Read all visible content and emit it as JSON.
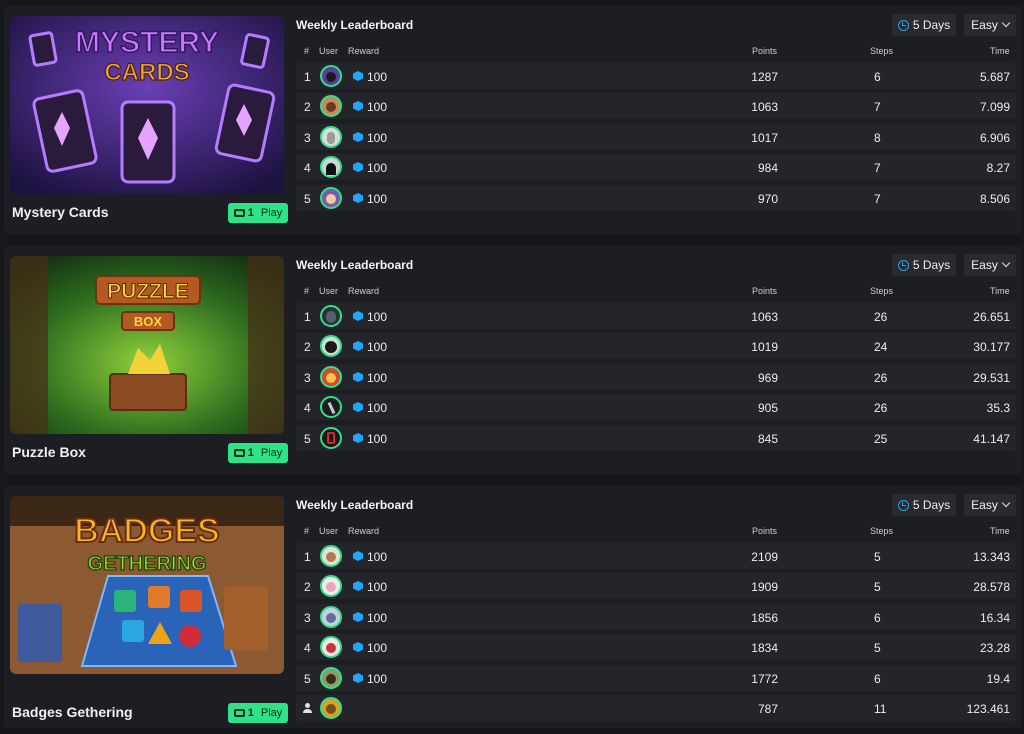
{
  "common": {
    "leaderboard_title": "Weekly Leaderboard",
    "period": "5 Days",
    "difficulty": "Easy",
    "headers": {
      "rank": "#",
      "user": "User",
      "reward": "Reward",
      "points": "Points",
      "steps": "Steps",
      "time": "Time"
    },
    "play_count": "1",
    "play_label": "Play",
    "icons": {
      "period": "clock-icon",
      "difficulty": "chevron-down-icon",
      "reward": "gem-icon",
      "play": "ticket-icon",
      "self": "user-icon"
    },
    "colors": {
      "play": "#2fe187",
      "gem": "#1ea7ff",
      "clock": "#2b9eea"
    }
  },
  "games": [
    {
      "name": "Mystery Cards",
      "thumb": {
        "title_top": "MYSTERY",
        "title_bottom": "CARDS"
      },
      "rows": [
        {
          "rank": "1",
          "reward": "100",
          "points": "1287",
          "steps": "6",
          "time": "5.687"
        },
        {
          "rank": "2",
          "reward": "100",
          "points": "1063",
          "steps": "7",
          "time": "7.099"
        },
        {
          "rank": "3",
          "reward": "100",
          "points": "1017",
          "steps": "8",
          "time": "6.906"
        },
        {
          "rank": "4",
          "reward": "100",
          "points": "984",
          "steps": "7",
          "time": "8.27"
        },
        {
          "rank": "5",
          "reward": "100",
          "points": "970",
          "steps": "7",
          "time": "8.506"
        }
      ]
    },
    {
      "name": "Puzzle Box",
      "thumb": {
        "title_top": "PUZZLE",
        "title_bottom": "BOX"
      },
      "rows": [
        {
          "rank": "1",
          "reward": "100",
          "points": "1063",
          "steps": "26",
          "time": "26.651"
        },
        {
          "rank": "2",
          "reward": "100",
          "points": "1019",
          "steps": "24",
          "time": "30.177"
        },
        {
          "rank": "3",
          "reward": "100",
          "points": "969",
          "steps": "26",
          "time": "29.531"
        },
        {
          "rank": "4",
          "reward": "100",
          "points": "905",
          "steps": "26",
          "time": "35.3"
        },
        {
          "rank": "5",
          "reward": "100",
          "points": "845",
          "steps": "25",
          "time": "41.147"
        }
      ]
    },
    {
      "name": "Badges Gethering",
      "thumb": {
        "title_top": "BADGES",
        "title_bottom": "GETHERING"
      },
      "rows": [
        {
          "rank": "1",
          "reward": "100",
          "points": "2109",
          "steps": "5",
          "time": "13.343"
        },
        {
          "rank": "2",
          "reward": "100",
          "points": "1909",
          "steps": "5",
          "time": "28.578"
        },
        {
          "rank": "3",
          "reward": "100",
          "points": "1856",
          "steps": "6",
          "time": "16.34"
        },
        {
          "rank": "4",
          "reward": "100",
          "points": "1834",
          "steps": "5",
          "time": "23.28"
        },
        {
          "rank": "5",
          "reward": "100",
          "points": "1772",
          "steps": "6",
          "time": "19.4"
        }
      ],
      "self_row": {
        "points": "787",
        "steps": "11",
        "time": "123.461"
      }
    }
  ]
}
